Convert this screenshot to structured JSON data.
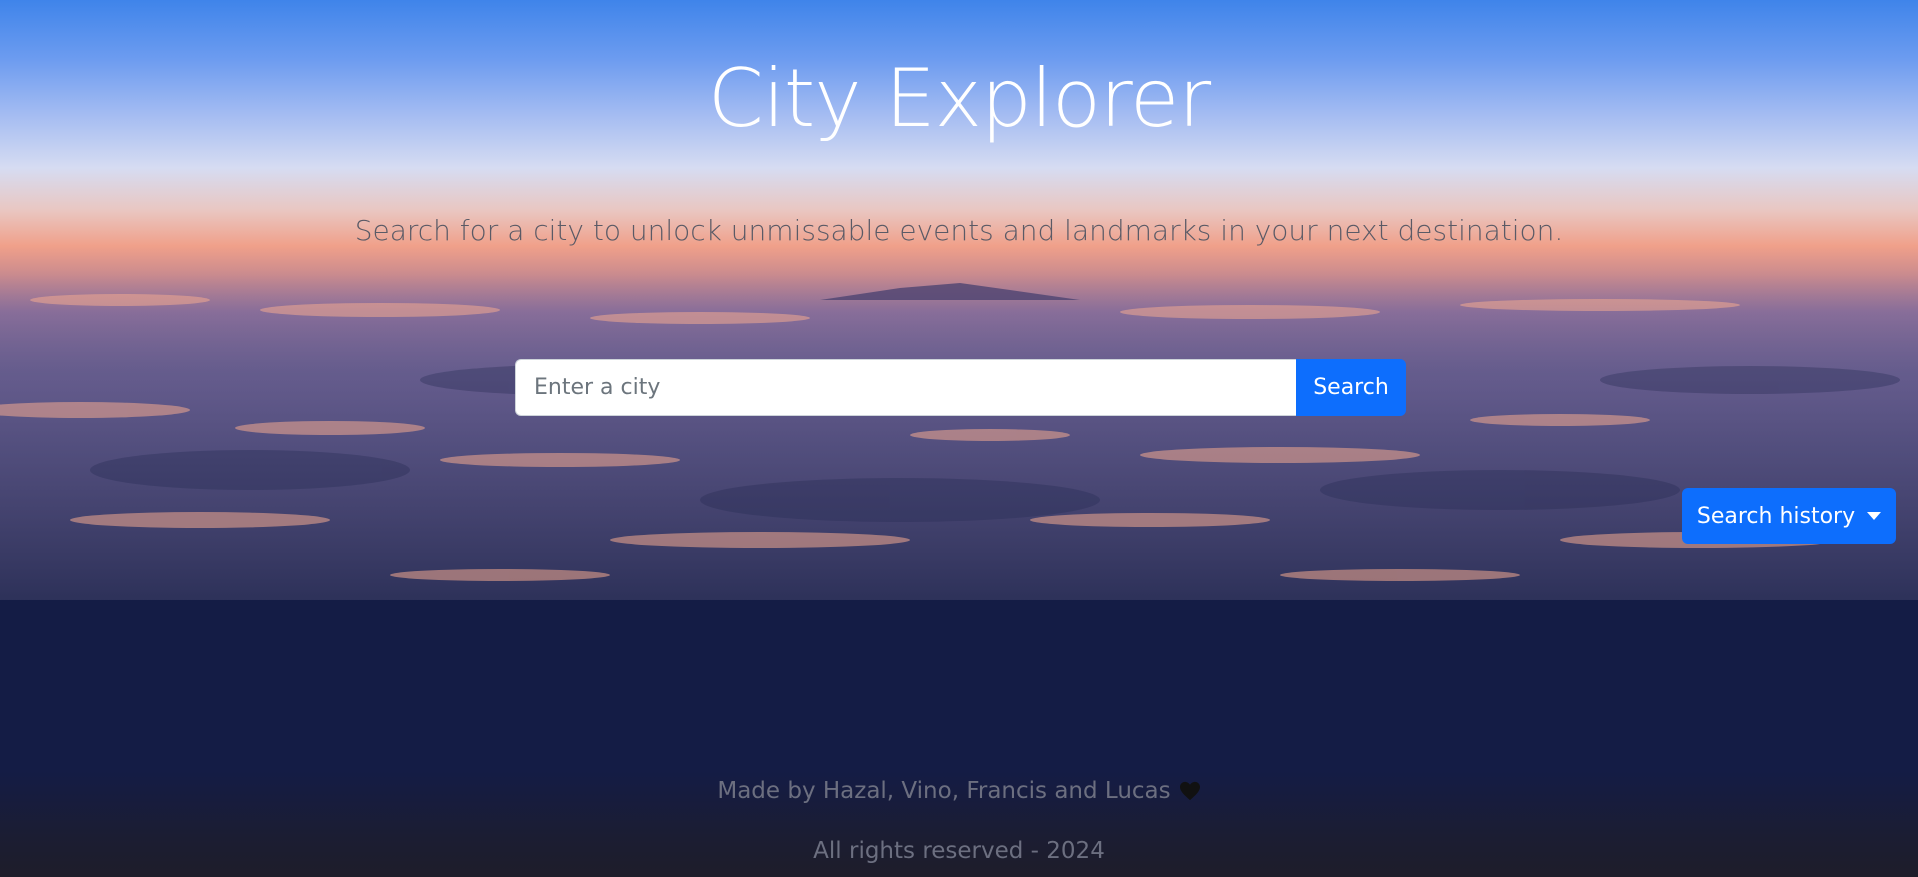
{
  "hero": {
    "title": "City Explorer",
    "subtitle": "Search for a city to unlock unmissable events and landmarks in your next destination."
  },
  "search": {
    "placeholder": "Enter a city",
    "value": "",
    "button_label": "Search"
  },
  "history": {
    "button_label": "Search history",
    "icon": "chevron-down-icon"
  },
  "footer": {
    "credits": "Made by Hazal, Vino, Francis and Lucas",
    "heart_icon": "heart-icon",
    "rights": "All rights reserved - 2024"
  },
  "colors": {
    "accent": "#0d6efd",
    "footer_bg": "#141c45",
    "footer_text": "#6c6f80"
  }
}
